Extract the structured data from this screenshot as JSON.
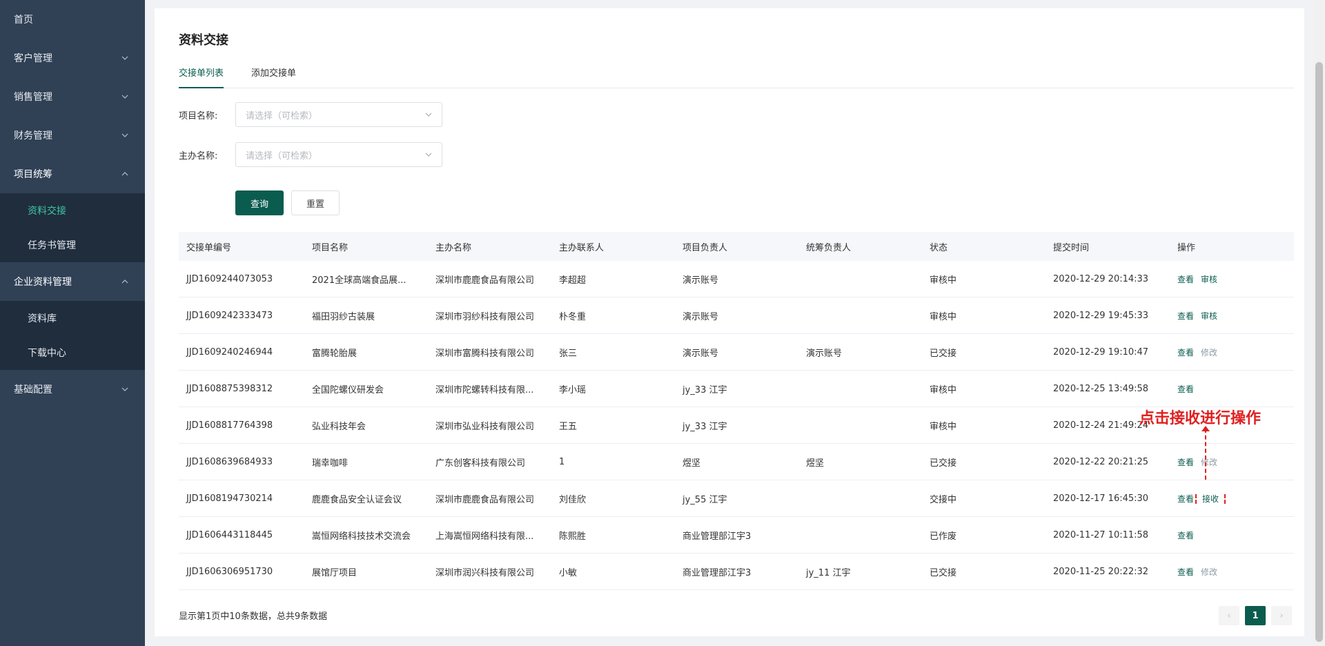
{
  "sidebar": {
    "items": [
      {
        "label": "首页",
        "has_chevron": false
      },
      {
        "label": "客户管理",
        "has_chevron": true
      },
      {
        "label": "销售管理",
        "has_chevron": true
      },
      {
        "label": "财务管理",
        "has_chevron": true
      },
      {
        "label": "项目统筹",
        "has_chevron": true,
        "expanded": true,
        "children": [
          "资料交接",
          "任务书管理"
        ]
      },
      {
        "label": "企业资料管理",
        "has_chevron": true,
        "expanded": true,
        "children": [
          "资料库",
          "下载中心"
        ]
      },
      {
        "label": "基础配置",
        "has_chevron": true
      }
    ],
    "active_child": "资料交接"
  },
  "page": {
    "title": "资料交接",
    "tabs": [
      "交接单列表",
      "添加交接单"
    ],
    "active_tab": "交接单列表"
  },
  "filters": {
    "project_label": "项目名称:",
    "project_placeholder": "请选择（可检索）",
    "host_label": "主办名称:",
    "host_placeholder": "请选择（可检索）",
    "search_button": "查询",
    "reset_button": "重置"
  },
  "table": {
    "columns": [
      "交接单编号",
      "项目名称",
      "主办名称",
      "主办联系人",
      "项目负责人",
      "统筹负责人",
      "状态",
      "提交时间",
      "操作"
    ],
    "rows": [
      {
        "id": "JJD1609244073053",
        "project": "2021全球高端食品展...",
        "host": "深圳市鹿鹿食品有限公司",
        "contact": "李超超",
        "pm": "演示账号",
        "coordinator": "",
        "status": "审核中",
        "time": "2020-12-29 20:14:33",
        "ops": [
          "查看",
          "审核"
        ]
      },
      {
        "id": "JJD1609242333473",
        "project": "福田羽纱古装展",
        "host": "深圳市羽纱科技有限公司",
        "contact": "朴冬重",
        "pm": "演示账号",
        "coordinator": "",
        "status": "审核中",
        "time": "2020-12-29 19:45:33",
        "ops": [
          "查看",
          "审核"
        ]
      },
      {
        "id": "JJD1609240246944",
        "project": "富腾轮胎展",
        "host": "深圳市富腾科技有限公司",
        "contact": "张三",
        "pm": "演示账号",
        "coordinator": "演示账号",
        "status": "已交接",
        "time": "2020-12-29 19:10:47",
        "ops": [
          "查看",
          "修改"
        ]
      },
      {
        "id": "JJD1608875398312",
        "project": "全国陀螺仪研发会",
        "host": "深圳市陀螺转科技有限...",
        "contact": "李小瑶",
        "pm": "jy_33 江宇",
        "coordinator": "",
        "status": "审核中",
        "time": "2020-12-25 13:49:58",
        "ops": [
          "查看"
        ]
      },
      {
        "id": "JJD1608817764398",
        "project": "弘业科技年会",
        "host": "深圳市弘业科技有限公司",
        "contact": "王五",
        "pm": "jy_33 江宇",
        "coordinator": "",
        "status": "审核中",
        "time": "2020-12-24 21:49:24",
        "ops": []
      },
      {
        "id": "JJD1608639684933",
        "project": "瑞幸咖啡",
        "host": "广东创客科技有限公司",
        "contact": "1",
        "pm": "煜坚",
        "coordinator": "煜坚",
        "status": "已交接",
        "time": "2020-12-22 20:21:25",
        "ops": [
          "查看",
          "修改"
        ]
      },
      {
        "id": "JJD1608194730214",
        "project": "鹿鹿食品安全认证会议",
        "host": "深圳市鹿鹿食品有限公司",
        "contact": "刘佳欣",
        "pm": "jy_55 江宇",
        "coordinator": "",
        "status": "交接中",
        "time": "2020-12-17 16:45:30",
        "ops": [
          "查看",
          "接收"
        ]
      },
      {
        "id": "JJD1606443118445",
        "project": "嵩恒网络科技技术交流会",
        "host": "上海嵩恒网络科技有限...",
        "contact": "陈熙胜",
        "pm": "商业管理部江宇3",
        "coordinator": "",
        "status": "已作废",
        "time": "2020-11-27 10:11:58",
        "ops": [
          "查看"
        ]
      },
      {
        "id": "JJD1606306951730",
        "project": "展馆厅项目",
        "host": "深圳市润兴科技有限公司",
        "contact": "小敏",
        "pm": "商业管理部江宇3",
        "coordinator": "jy_11 江宇",
        "status": "已交接",
        "time": "2020-11-25 20:22:32",
        "ops": [
          "查看",
          "修改"
        ]
      }
    ]
  },
  "footer": {
    "summary": "显示第1页中10条数据，总共9条数据",
    "prev": "‹",
    "current_page": "1",
    "next": "›"
  },
  "annotation": {
    "text": "点击接收进行操作"
  },
  "colors": {
    "sidebar_bg": "#304156",
    "submenu_bg": "#1f2d3d",
    "accent": "#0a5c4f",
    "active_submenu": "#3fc7a3",
    "annotation": "#e02020"
  }
}
